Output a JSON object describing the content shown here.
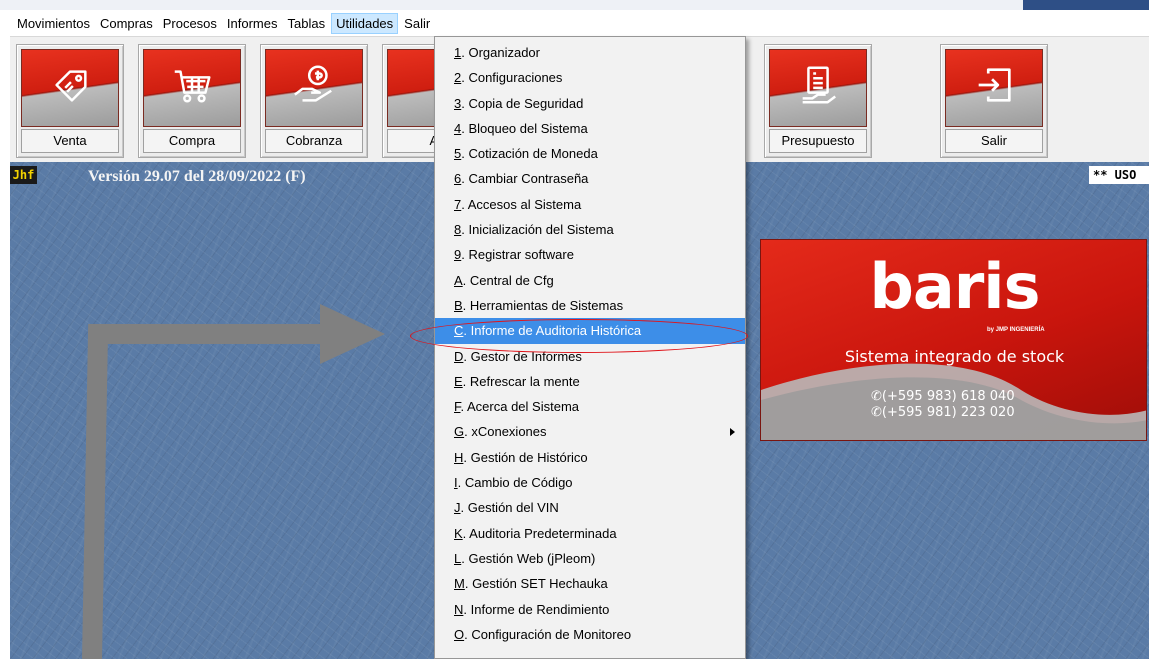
{
  "menubar": {
    "items": [
      "Movimientos",
      "Compras",
      "Procesos",
      "Informes",
      "Tablas",
      "Utilidades",
      "Salir"
    ],
    "active": "Utilidades"
  },
  "toolbar": {
    "buttons": [
      {
        "label": "Venta",
        "icon": "money-tag-icon"
      },
      {
        "label": "Compra",
        "icon": "shopping-cart-icon"
      },
      {
        "label": "Cobranza",
        "icon": "hand-coin-icon"
      },
      {
        "label": "Ar",
        "icon": "partially-hidden-icon"
      },
      {
        "label": "Presupuesto",
        "icon": "budget-document-icon"
      },
      {
        "label": "Salir",
        "icon": "exit-icon"
      }
    ]
  },
  "status": {
    "badge": "Jhf",
    "version": "Versión 29.07 del 28/09/2022  (F)",
    "right_badge": "** USO"
  },
  "logo": {
    "name": "baris",
    "by": "by JMP INGENIERÍA",
    "tagline": "Sistema integrado de stock",
    "phones": [
      "(+595 983) 618 040",
      "(+595 981) 223 020"
    ]
  },
  "dropdown": {
    "items": [
      {
        "key": "1",
        "label": ". Organizador"
      },
      {
        "key": "2",
        "label": ". Configuraciones"
      },
      {
        "key": "3",
        "label": ". Copia de Seguridad"
      },
      {
        "key": "4",
        "label": ". Bloqueo del Sistema"
      },
      {
        "key": "5",
        "label": ". Cotización de Moneda"
      },
      {
        "key": "6",
        "label": ". Cambiar Contraseña"
      },
      {
        "key": "7",
        "label": ". Accesos al Sistema"
      },
      {
        "key": "8",
        "label": ". Inicialización del Sistema"
      },
      {
        "key": "9",
        "label": ". Registrar software"
      },
      {
        "key": "A",
        "label": ". Central de Cfg"
      },
      {
        "key": "B",
        "label": ". Herramientas de Sistemas"
      },
      {
        "key": "C",
        "label": ". Informe de Auditoria Histórica"
      },
      {
        "key": "D",
        "label": ". Gestor de Informes"
      },
      {
        "key": "E",
        "label": ". Refrescar la mente"
      },
      {
        "key": "F",
        "label": ". Acerca del Sistema"
      },
      {
        "key": "G",
        "label": ". xConexiones"
      },
      {
        "key": "H",
        "label": ". Gestión de Histórico"
      },
      {
        "key": "I",
        "label": ". Cambio de Código"
      },
      {
        "key": "J",
        "label": ". Gestión del VIN"
      },
      {
        "key": "K",
        "label": ". Auditoria Predeterminada"
      },
      {
        "key": "L",
        "label": ". Gestión Web (jPleom)"
      },
      {
        "key": "M",
        "label": ". Gestión SET Hechauka"
      },
      {
        "key": "N",
        "label": ". Informe de Rendimiento"
      },
      {
        "key": "O",
        "label": ". Configuración de Monitoreo"
      }
    ],
    "highlighted_index": 11,
    "submenu_index": 15
  },
  "colors": {
    "workarea": "#5a7ba6",
    "highlight": "#3d8ee8",
    "annotation": "#e0141a",
    "brand_red": "#d41f12"
  }
}
